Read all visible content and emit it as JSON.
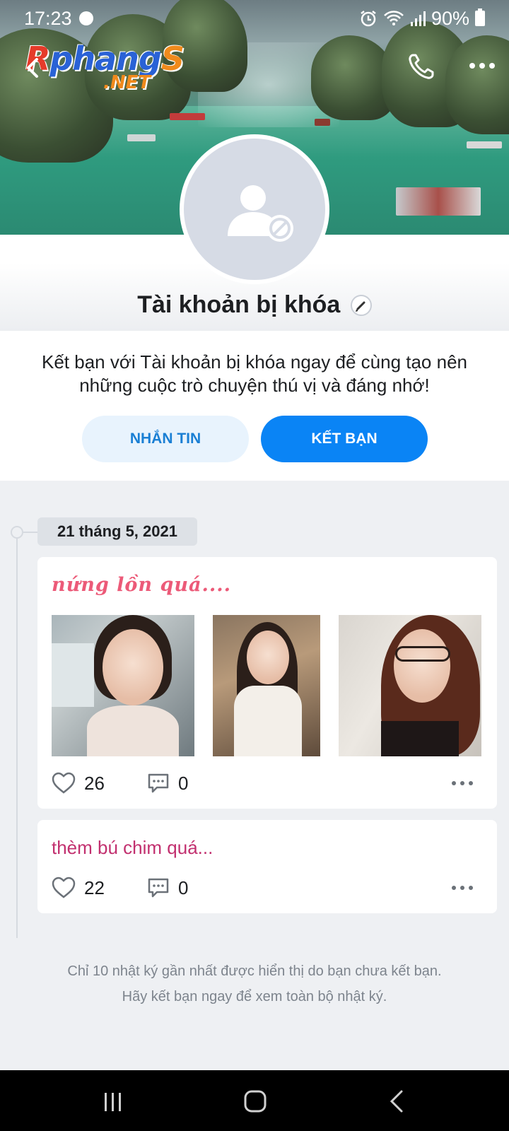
{
  "status_bar": {
    "time": "17:23",
    "battery": "90%"
  },
  "watermark": {
    "line1_r": "R",
    "line1_main": "phang",
    "line1_s": "S",
    "line2": ".NET"
  },
  "profile": {
    "name": "Tài khoản bị khóa",
    "invite_text": "Kết bạn với Tài khoản bị khóa ngay để cùng tạo nên những cuộc trò chuyện thú vị và đáng nhớ!",
    "message_button": "NHẮN TIN",
    "add_friend_button": "KẾT BẠN"
  },
  "timeline": {
    "date": "21 tháng 5, 2021",
    "posts": [
      {
        "title": "nứng lồn quá....",
        "likes": "26",
        "comments": "0"
      },
      {
        "title": "thèm bú chim quá...",
        "likes": "22",
        "comments": "0"
      }
    ]
  },
  "footer_note": {
    "line1": "Chỉ 10 nhật ký gần nhất được hiển thị do bạn chưa kết bạn.",
    "line2": "Hãy kết bạn ngay để xem toàn bộ nhật ký."
  },
  "colors": {
    "primary": "#0a84f5",
    "secondary_button_bg": "#e8f3fd",
    "post_title_1": "#ec5a78",
    "post_title_2": "#c2306f"
  },
  "icons": {
    "back": "back-arrow-icon",
    "call": "phone-icon",
    "more": "more-dots-icon",
    "avatar": "blocked-user-icon",
    "edit": "pencil-icon",
    "like": "heart-icon",
    "comment": "comment-icon"
  }
}
